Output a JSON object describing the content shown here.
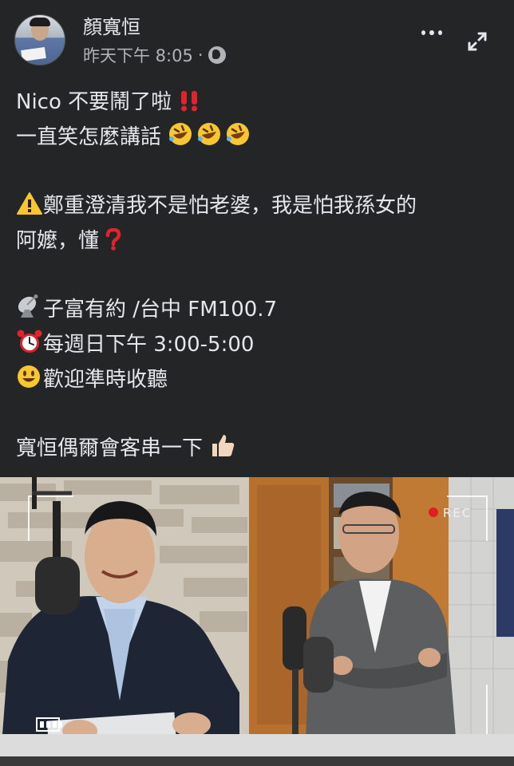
{
  "post": {
    "author": "顏寬恒",
    "timestamp": "昨天下午 8:05",
    "separator": "·",
    "privacy_icon": "globe-icon",
    "lines": [
      {
        "text": "Nico 不要鬧了啦",
        "emoji_after": "double-exclamation"
      },
      {
        "text": "一直笑怎麼講話",
        "emoji_after": "rofl-x3"
      },
      {
        "text": "鄭重澄清我不是怕老婆，我是怕我孫女的",
        "emoji_before": "warning"
      },
      {
        "text": "阿嬤，懂",
        "emoji_after": "red-question"
      },
      {
        "text": "子富有約 /台中 FM100.7",
        "emoji_before": "satellite-dish"
      },
      {
        "text": "每週日下午 3:00-5:00",
        "emoji_before": "alarm-clock"
      },
      {
        "text": "歡迎準時收聽",
        "emoji_before": "smiley"
      },
      {
        "text": "寬恒偶爾會客串一下",
        "emoji_after": "thumbs-up"
      }
    ]
  },
  "photo": {
    "description_icon": "radio-studio-photo",
    "rec_label": "REC",
    "rec_color": "#e02020"
  },
  "colors": {
    "background": "#242526",
    "text": "#e4e6eb",
    "secondary_text": "#b0b3b8"
  }
}
